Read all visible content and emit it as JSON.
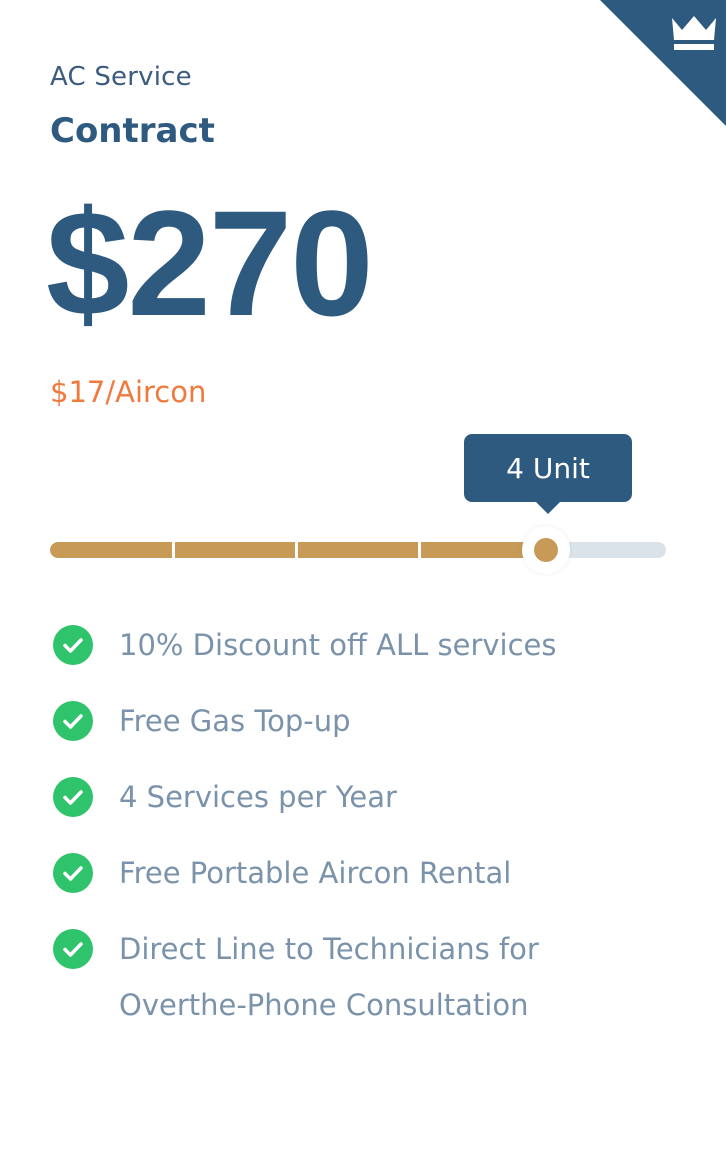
{
  "plan": {
    "service_label": "AC Service",
    "plan_name": "Contract",
    "price": "$270",
    "per_unit": "$17/Aircon"
  },
  "ribbon": {
    "icon": "crown-icon",
    "color": "#2f5a80"
  },
  "slider": {
    "tooltip": "4 Unit",
    "value_fraction": 0.805,
    "fill_color": "#c79a57",
    "track_color": "#dae3ea"
  },
  "features": [
    {
      "icon": "check-circle-icon",
      "text": "10% Discount off ALL services"
    },
    {
      "icon": "check-circle-icon",
      "text": "Free Gas Top-up"
    },
    {
      "icon": "check-circle-icon",
      "text": "4 Services per Year"
    },
    {
      "icon": "check-circle-icon",
      "text": "Free Portable Aircon Rental"
    },
    {
      "icon": "check-circle-icon",
      "text": "Direct Line to Technicians for Overthe-Phone Consultation"
    }
  ],
  "colors": {
    "primary": "#2f5a80",
    "accent_orange": "#f07a3e",
    "check_green": "#2fc46b",
    "feature_text": "#7a93ab"
  }
}
